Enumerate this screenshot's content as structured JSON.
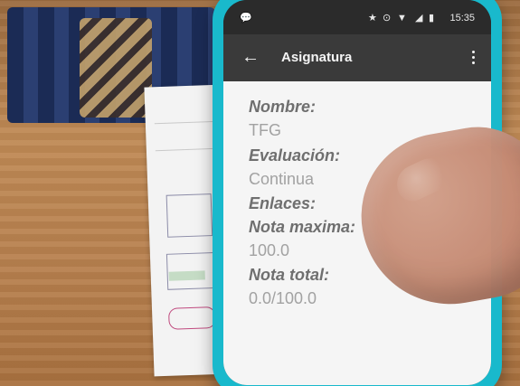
{
  "status_bar": {
    "left_icon": "chat-bubble-icon",
    "icons": [
      "star-icon",
      "signal-icon",
      "wifi-icon",
      "cellular-icon",
      "battery-icon"
    ],
    "time": "15:35"
  },
  "app_bar": {
    "title": "Asignatura",
    "back_icon": "arrow-back-icon",
    "overflow_icon": "more-vert-icon"
  },
  "details": {
    "nombre_label": "Nombre:",
    "nombre_value": "TFG",
    "evaluacion_label": "Evaluación:",
    "evaluacion_value": "Continua",
    "enlaces_label": "Enlaces:",
    "nota_maxima_label": "Nota maxima:",
    "nota_maxima_value": "100.0",
    "nota_total_label": "Nota total:",
    "nota_total_value": "0.0/100.0"
  }
}
